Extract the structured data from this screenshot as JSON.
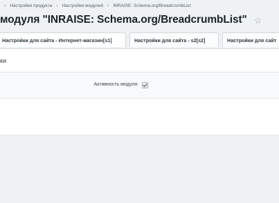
{
  "breadcrumb": {
    "items": [
      {
        "label": "Настройки продукта"
      },
      {
        "label": "Настройки модулей"
      },
      {
        "label": "INRAISE: Schema.org/BreadcrumbList"
      }
    ],
    "separator": "›"
  },
  "header": {
    "title": "модуля \"INRAISE: Schema.org/BreadcrumbList\"",
    "favorite_icon": "star-icon"
  },
  "tabs": [
    {
      "label": "Настройки для сайта - Интернет-магазин[s1]",
      "active": true
    },
    {
      "label": "Настройки для сайта - s2[s2]",
      "active": false
    },
    {
      "label": "Настройки для сайт",
      "active": false
    }
  ],
  "panel": {
    "section_title": "ки",
    "settings": [
      {
        "label": "Активность модуля:",
        "checked": true
      }
    ]
  },
  "colors": {
    "background": "#eef2f4",
    "panel": "#ffffff",
    "title_text": "#1b2227"
  }
}
